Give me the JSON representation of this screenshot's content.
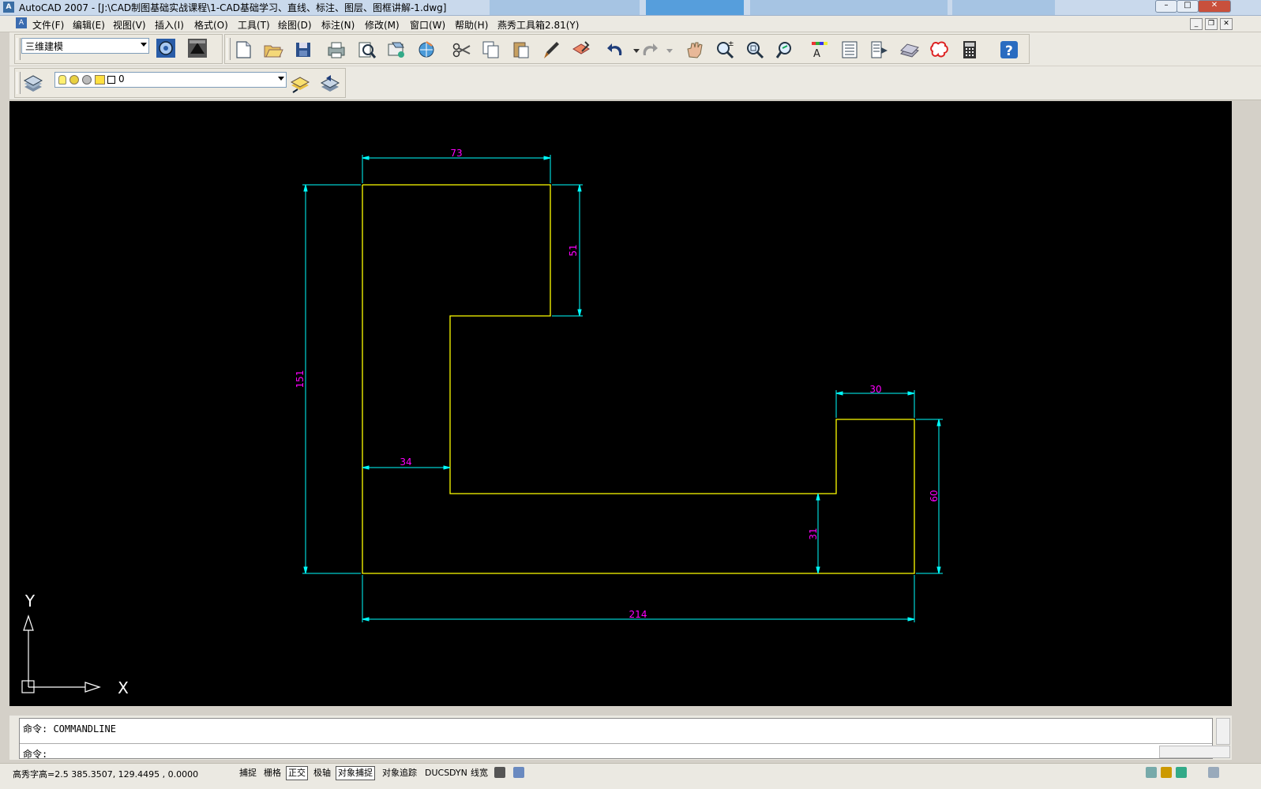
{
  "window": {
    "title": "AutoCAD 2007 - [J:\\CAD制图基础实战课程\\1-CAD基础学习、直线、标注、图层、图框讲解-1.dwg]",
    "app_icon": "A"
  },
  "menu": {
    "items": [
      "文件(F)",
      "编辑(E)",
      "视图(V)",
      "插入(I)",
      "格式(O)",
      "工具(T)",
      "绘图(D)",
      "标注(N)",
      "修改(M)",
      "窗口(W)",
      "帮助(H)",
      "燕秀工具箱2.81(Y)"
    ]
  },
  "toolbar": {
    "workspace": "三维建模",
    "layer": "0",
    "icons": [
      "settings-icon",
      "workspace-icon",
      "new-file-icon",
      "open-file-icon",
      "save-icon",
      "print-icon",
      "print-preview-icon",
      "publish-icon",
      "3d-publish-icon",
      "cut-icon",
      "copy-icon",
      "paste-icon",
      "match-properties-icon",
      "block-editor-icon",
      "undo-icon",
      "redo-icon",
      "pan-icon",
      "zoom-realtime-icon",
      "zoom-window-icon",
      "zoom-previous-icon",
      "properties-icon",
      "design-center-icon",
      "tool-palettes-icon",
      "sheet-set-icon",
      "markup-icon",
      "quickcalc-icon",
      "help-icon"
    ]
  },
  "drawing": {
    "dimensions": {
      "top_width": "73",
      "notch_height": "51",
      "total_height": "151",
      "inner_width": "34",
      "right_block_width": "30",
      "right_block_height": "60",
      "step_height": "31",
      "total_width": "214"
    },
    "ucs": {
      "x_label": "X",
      "y_label": "Y"
    },
    "colors": {
      "background": "#000000",
      "geometry": "#ffff00",
      "dimension_line": "#00ffff",
      "dimension_text": "#ff00ff",
      "ucs": "#ffffff"
    }
  },
  "command": {
    "line1": "命令: COMMANDLINE",
    "prompt": "命令:"
  },
  "status": {
    "coords": "高秀字高=2.5   385.3507, 129.4495 , 0.0000",
    "buttons": [
      {
        "label": "捕捉",
        "on": false
      },
      {
        "label": "栅格",
        "on": false
      },
      {
        "label": "正交",
        "on": true
      },
      {
        "label": "极轴",
        "on": false
      },
      {
        "label": "对象捕捉",
        "on": true
      },
      {
        "label": "对象追踪",
        "on": false
      },
      {
        "label": "DUCS",
        "on": false
      },
      {
        "label": "DYN",
        "on": false
      },
      {
        "label": "线宽",
        "on": false
      }
    ]
  }
}
